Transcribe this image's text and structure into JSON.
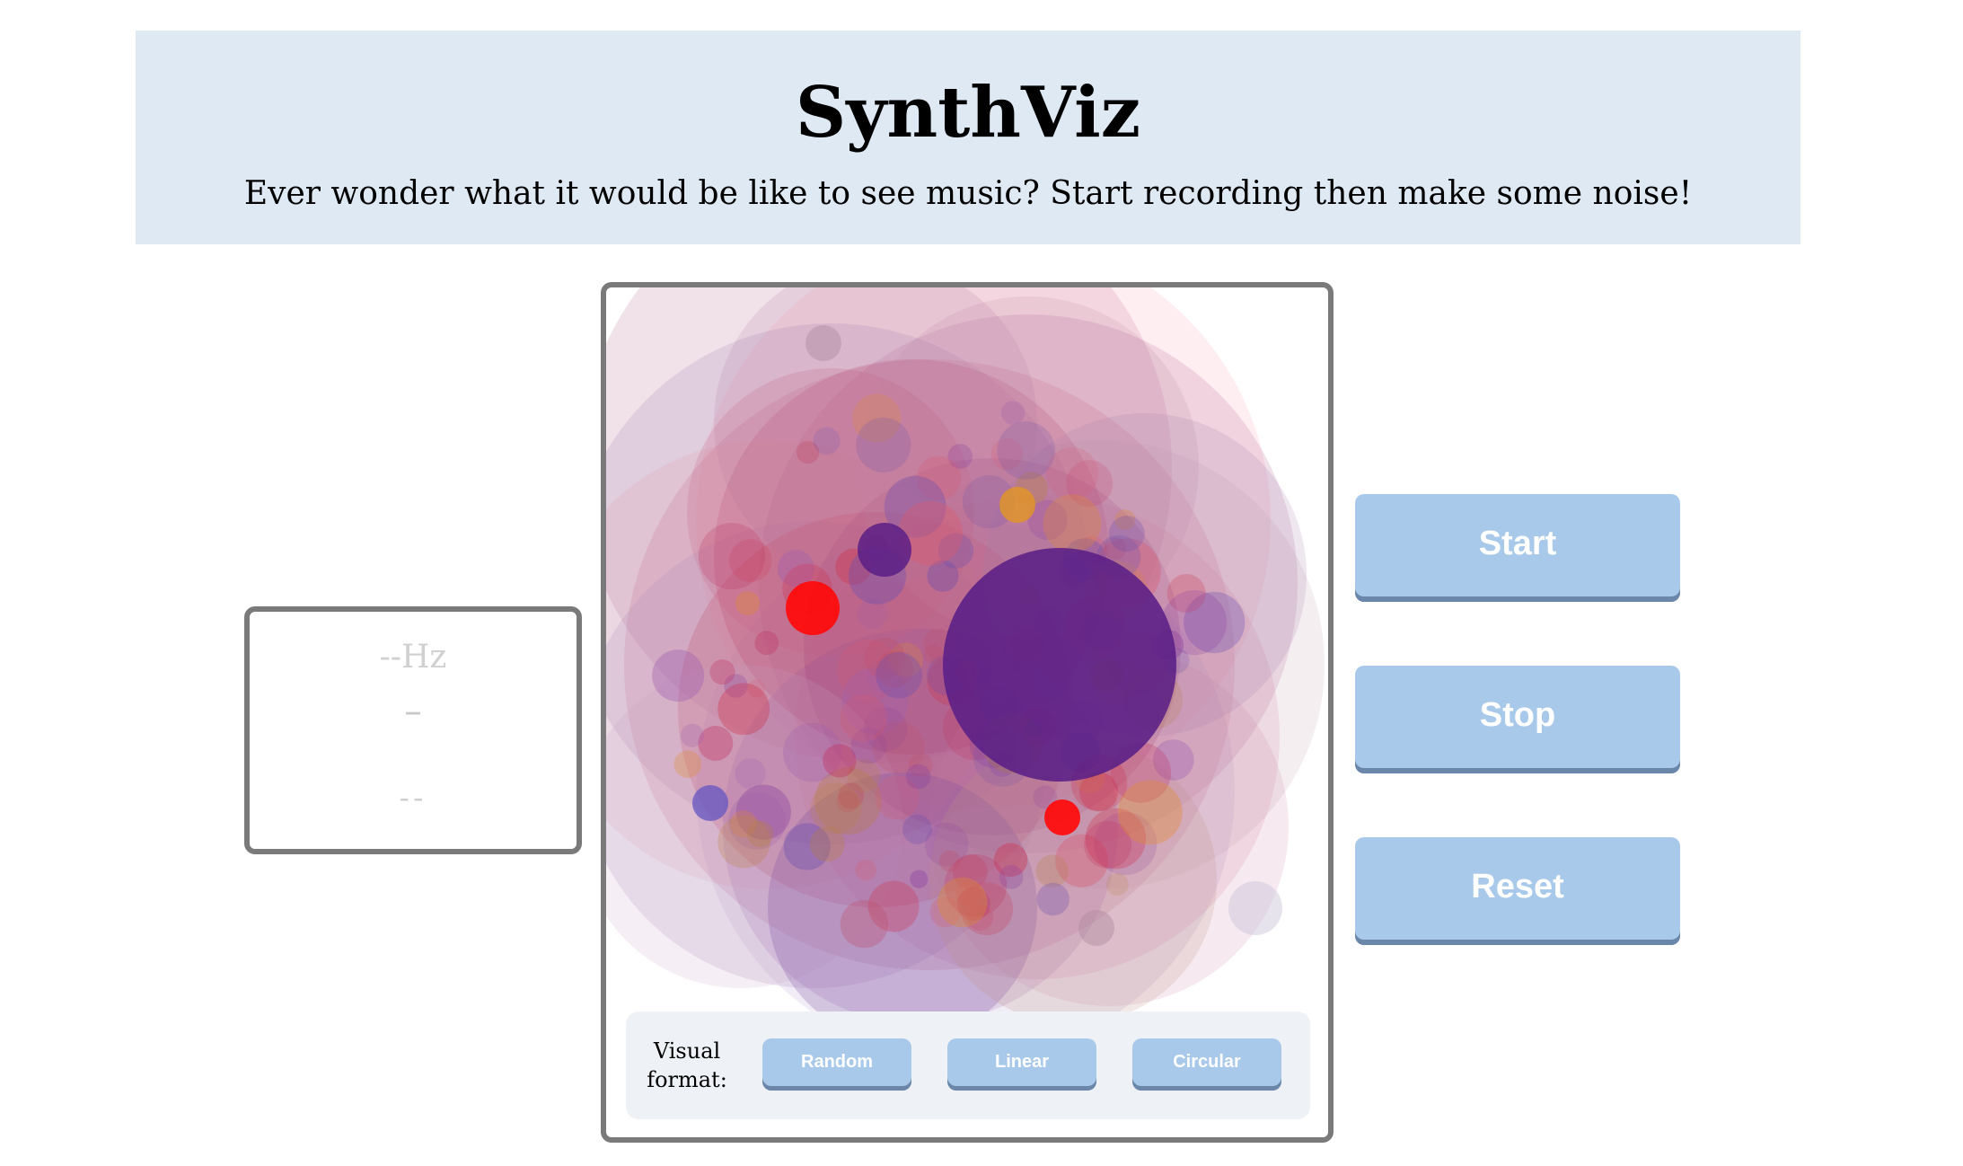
{
  "header": {
    "title": "SynthViz",
    "subtitle": "Ever wonder what it would be like to see music? Start recording then make some noise!"
  },
  "readout": {
    "frequency": "--Hz",
    "note": "–",
    "cents": "--"
  },
  "visual_format": {
    "label": "Visual format:",
    "options": [
      "Random",
      "Linear",
      "Circular"
    ]
  },
  "controls": {
    "start_label": "Start",
    "stop_label": "Stop",
    "reset_label": "Reset"
  },
  "colors": {
    "header_bg": "#dfe9f3",
    "button_bg": "#a9c9ea",
    "button_shadow": "#6a86a8",
    "frame_border": "#7a7a7a",
    "accent_purple": "#5a1f86",
    "accent_red": "#ff0a0a",
    "accent_orange": "#e0942a"
  }
}
